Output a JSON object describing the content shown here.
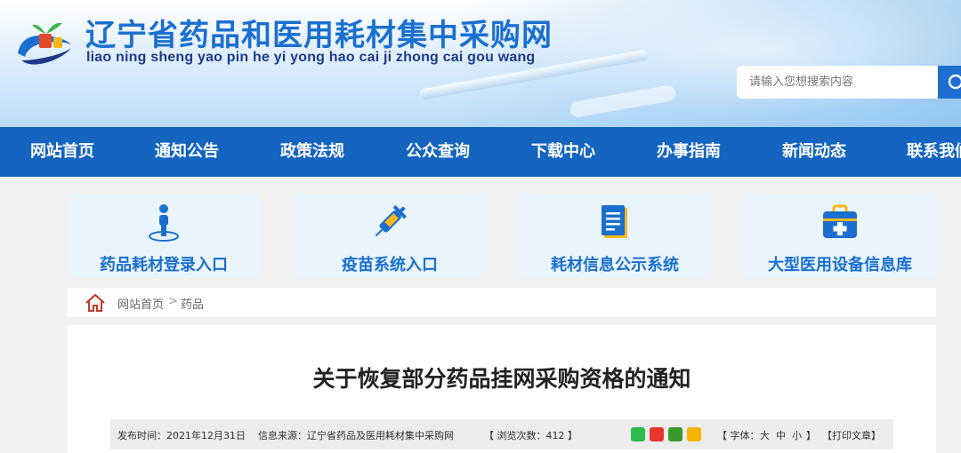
{
  "header": {
    "title": "辽宁省药品和医用耗材集中采购网",
    "pinyin": "liao ning sheng yao pin he yi yong hao cai ji zhong cai gou wang",
    "search_placeholder": "请输入您想搜索内容"
  },
  "nav": {
    "items": [
      {
        "label": "网站首页"
      },
      {
        "label": "通知公告"
      },
      {
        "label": "政策法规"
      },
      {
        "label": "公众查询"
      },
      {
        "label": "下载中心"
      },
      {
        "label": "办事指南"
      },
      {
        "label": "新闻动态"
      },
      {
        "label": "联系我们"
      }
    ]
  },
  "cards": [
    {
      "label": "药品耗材登录入口",
      "icon": "person-icon"
    },
    {
      "label": "疫苗系统入口",
      "icon": "syringe-icon"
    },
    {
      "label": "耗材信息公示系统",
      "icon": "document-icon"
    },
    {
      "label": "大型医用设备信息库",
      "icon": "medical-kit-icon"
    }
  ],
  "breadcrumb": {
    "home": "网站首页",
    "separator": ">",
    "current": "药品"
  },
  "article": {
    "title": "关于恢复部分药品挂网采购资格的通知",
    "meta": {
      "publish_time": "发布时间：2021年12月31日",
      "source": "信息来源：辽宁省药品及医用耗材集中采购网",
      "views": "【 浏览次数：412 】",
      "font_label": "【 字体：",
      "font_large": "大",
      "font_medium": "中",
      "font_small": "小",
      "font_end": "】",
      "print": "【打印文章】"
    }
  },
  "colors": {
    "brand_blue": "#1464c0",
    "title_blue": "#1a6fd0",
    "card_bg": "#eaf4fd",
    "home_icon_red": "#c0392b"
  }
}
